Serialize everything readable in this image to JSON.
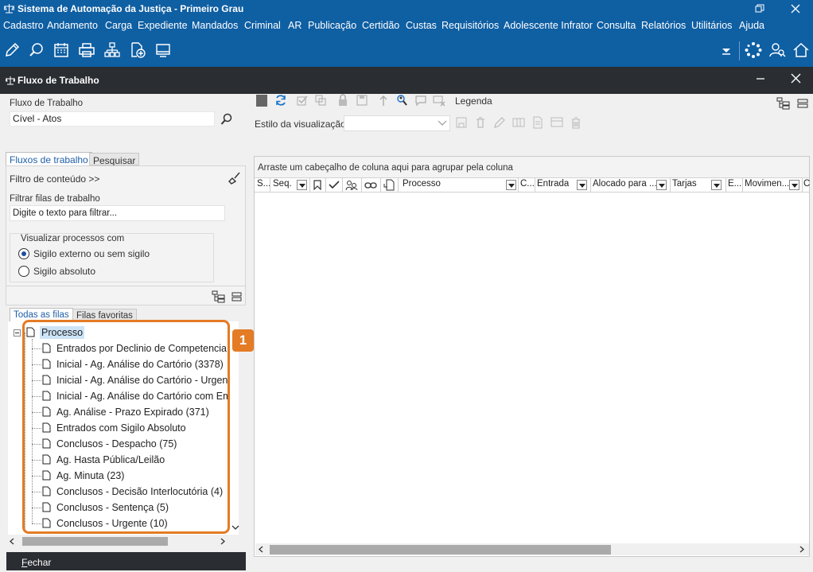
{
  "window": {
    "title": "Sistema de Automação da Justiça - Primeiro Grau"
  },
  "menu": {
    "items": [
      "Cadastro",
      "Andamento",
      "Carga",
      "Expediente",
      "Mandados",
      "Criminal",
      "AR",
      "Publicação",
      "Certidão",
      "Custas",
      "Requisitórios",
      "Adolescente Infrator",
      "Consulta",
      "Relatórios",
      "Utilitários",
      "Ajuda"
    ]
  },
  "toolbar": {
    "icons": [
      "edit-icon",
      "search-process-icon",
      "calendar-icon",
      "printer-icon",
      "organization-icon",
      "add-page-icon",
      "screen-icon"
    ],
    "right_icons": [
      "dropdown-arrow-icon",
      "loading-icon",
      "user-search-icon",
      "home-icon"
    ]
  },
  "panel": {
    "title": "Fluxo de Trabalho"
  },
  "workflow": {
    "label": "Fluxo de Trabalho",
    "value": "Cível - Atos"
  },
  "view": {
    "style_label": "Estilo da visualização",
    "legend_label": "Legenda",
    "style_value": ""
  },
  "tabs": {
    "flows": "Fluxos de trabalho",
    "search": "Pesquisar"
  },
  "filter": {
    "content_filter": "Filtro de conteúdo >>",
    "queues_label": "Filtrar filas de trabalho",
    "placeholder": "Digite o texto para filtrar..."
  },
  "visibility": {
    "group_label": "Visualizar processos com",
    "options": [
      "Sigilo externo ou sem sigilo",
      "Sigilo absoluto"
    ],
    "selected": "Sigilo externo ou sem sigilo"
  },
  "queue_tabs": {
    "all": "Todas as filas",
    "favorites": "Filas favoritas"
  },
  "tree": {
    "root": "Processo",
    "items": [
      "Entrados por Declinio de Competencia - T",
      "Inicial - Ag. Análise do Cartório (3378)",
      "Inicial - Ag. Análise do Cartório - Urgente",
      "Inicial - Ag. Análise do Cartório com Eme",
      "Ag. Análise - Prazo Expirado (371)",
      "Entrados com Sigilo Absoluto",
      "Conclusos - Despacho (75)",
      "Ag. Hasta Pública/Leilão",
      "Ag. Minuta (23)",
      "Conclusos - Decisão Interlocutória (4)",
      "Conclusos - Sentença (5)",
      "Conclusos - Urgente (10)"
    ]
  },
  "callout": {
    "number": "1",
    "color": "#e47b25"
  },
  "grid": {
    "group_hint": "Arraste um cabeçalho de coluna aqui para agrupar pela coluna",
    "columns": [
      "S...",
      "Seq.",
      "Processo",
      "C...",
      "Entrada",
      "Alocado para ...",
      "Tarjas",
      "E...",
      "Movimen...",
      "C"
    ]
  },
  "footer": {
    "close_first": "F",
    "close_rest": "echar"
  },
  "colors": {
    "title_blue": "#0f5fa3",
    "dark_header": "#2a2d31",
    "accent_orange": "#e47b25"
  }
}
